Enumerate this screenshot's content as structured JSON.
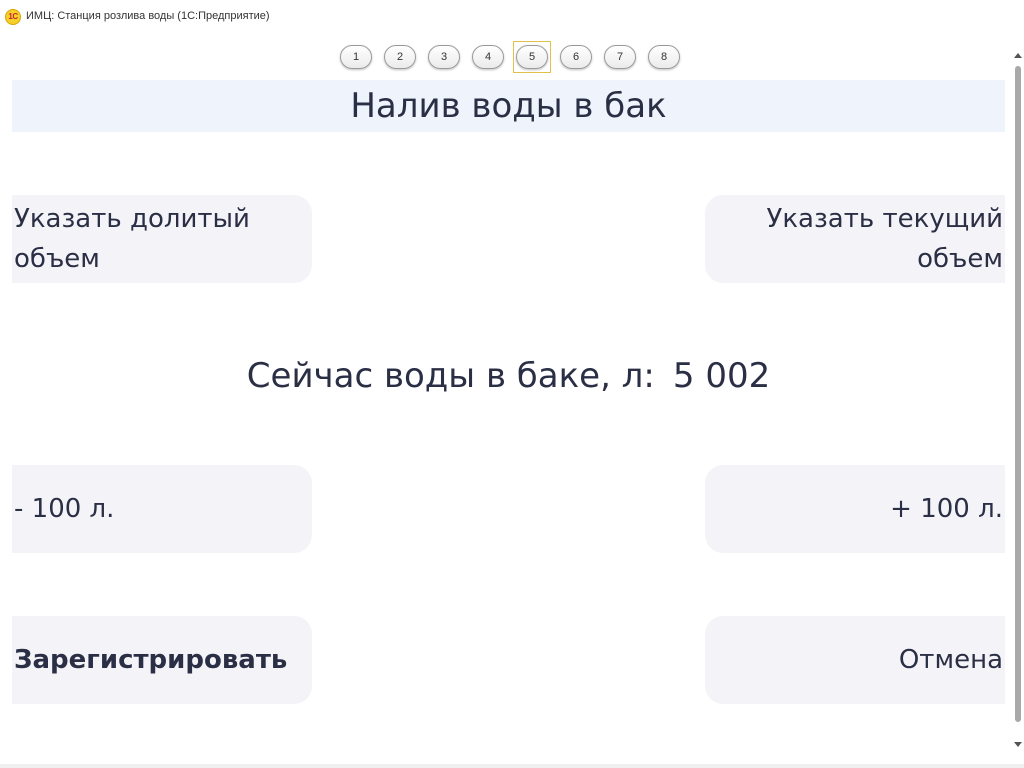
{
  "window": {
    "logo_text": "1C",
    "title": "ИМЦ: Станция розлива воды  (1С:Предприятие)"
  },
  "pager": {
    "pages": [
      "1",
      "2",
      "3",
      "4",
      "5",
      "6",
      "7",
      "8"
    ],
    "active": "5"
  },
  "header": {
    "title": "Налив воды в бак"
  },
  "buttons": {
    "set_added_volume": "Указать долитый объем",
    "set_current_volume": "Указать текущий объем",
    "minus_100": "- 100 л.",
    "plus_100": "+ 100 л.",
    "register": "Зарегистрировать",
    "cancel": "Отмена"
  },
  "level": {
    "label": "Сейчас воды в баке, л:",
    "value": "5 002"
  },
  "colors": {
    "header_band": "#eef3fc",
    "button_bg": "#f4f4f8",
    "text": "#2b2f45",
    "active_page_outline": "#e0c14a"
  },
  "icons": {
    "app_logo": "1c-logo-icon",
    "scroll_up": "scroll-up-icon",
    "scroll_down": "scroll-down-icon"
  }
}
